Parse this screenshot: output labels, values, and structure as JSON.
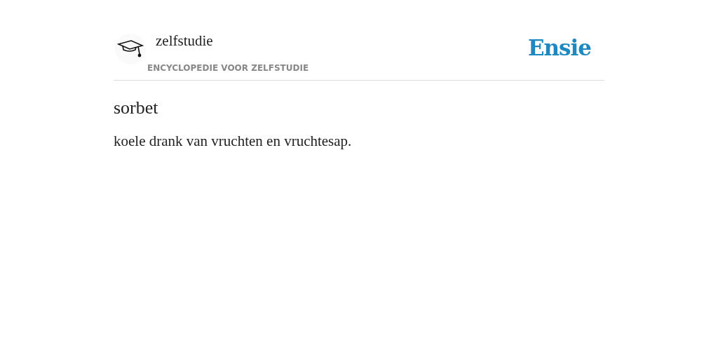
{
  "header": {
    "site_title": "zelfstudie",
    "subtitle": "ENCYCLOPEDIE VOOR ZELFSTUDIE",
    "brand": "Ensie"
  },
  "article": {
    "title": "sorbet",
    "definition": "koele drank van vruchten en vruchtesap."
  }
}
